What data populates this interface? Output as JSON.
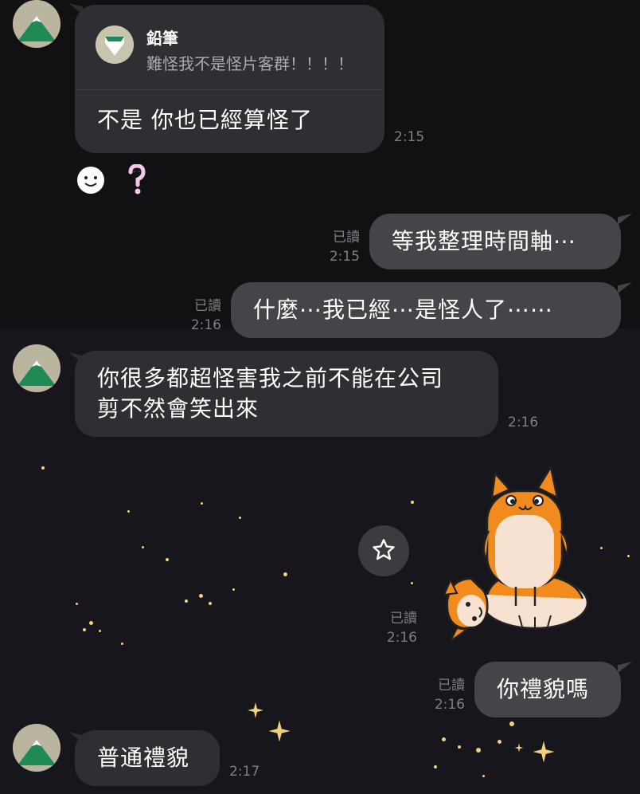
{
  "colors": {
    "incoming_bubble": "#2f2f33",
    "outgoing_bubble": "#454549",
    "meta_text": "#7e7e84",
    "background": "#141418",
    "sparkle": "#f0d27a"
  },
  "messages": [
    {
      "direction": "incoming",
      "reply": {
        "author": "鉛筆",
        "text": "難怪我不是怪片客群！！！！"
      },
      "text": "不是 你也已經算怪了",
      "time": "2:15",
      "reactions": [
        "smile-reaction-icon",
        "sticker-reaction-icon"
      ]
    },
    {
      "direction": "outgoing",
      "read": "已讀",
      "time": "2:15",
      "text": "等我整理時間軸⋯"
    },
    {
      "direction": "outgoing",
      "read": "已讀",
      "time": "2:16",
      "text": "什麼⋯我已經⋯是怪人了⋯⋯"
    },
    {
      "direction": "incoming",
      "text": "你很多都超怪害我之前不能在公司\n剪不然會笑出來",
      "time": "2:16"
    },
    {
      "direction": "outgoing",
      "type": "sticker",
      "sticker": "cat-stack-sticker",
      "read": "已讀",
      "time": "2:16"
    },
    {
      "direction": "outgoing",
      "read": "已讀",
      "time": "2:16",
      "text": "你禮貌嗎"
    },
    {
      "direction": "incoming",
      "text": "普通禮貌",
      "time": "2:17"
    }
  ],
  "icons": {
    "favorite": "star-icon",
    "avatar": "mountain-avatar-icon"
  }
}
